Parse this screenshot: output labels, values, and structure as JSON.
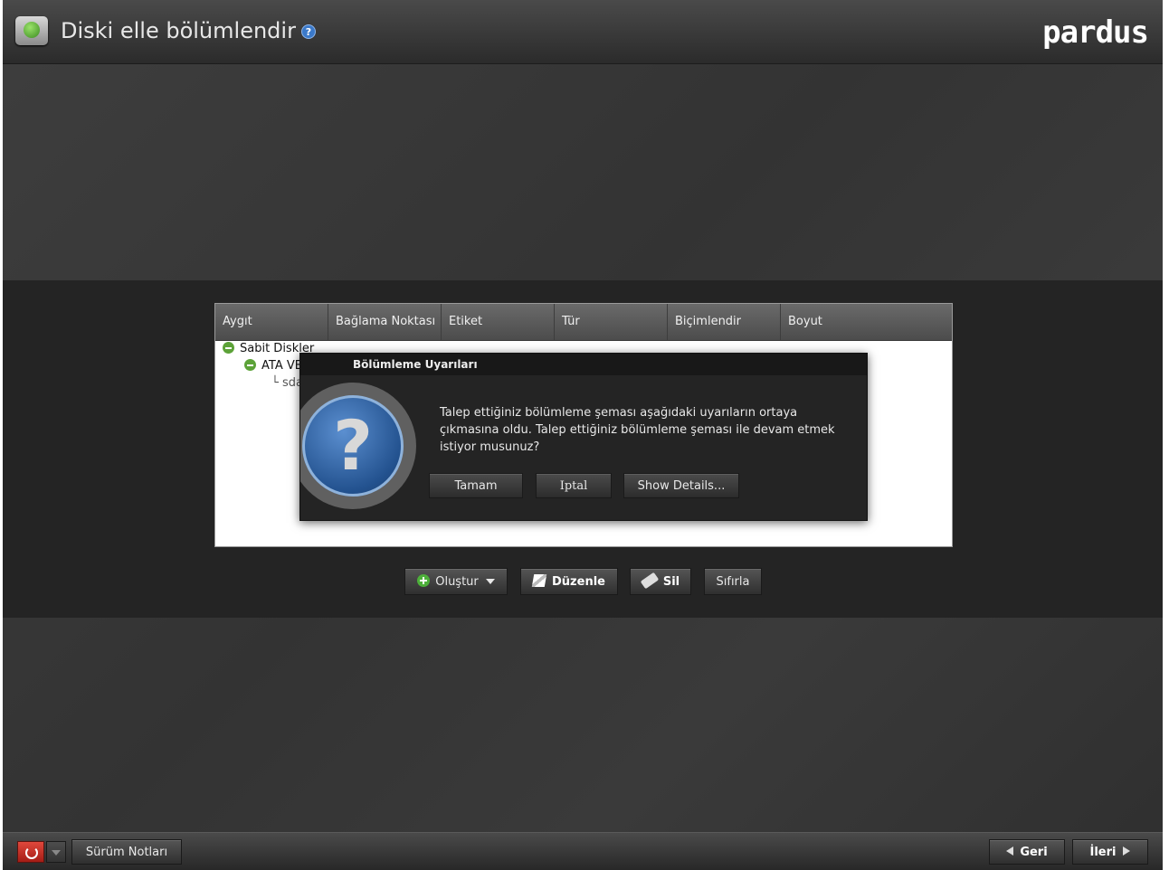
{
  "window": {
    "title": "Diski elle bölümlendir",
    "logo": "pardus"
  },
  "table": {
    "headers": [
      "Aygıt",
      "Bağlama Noktası",
      "Etiket",
      "Tür",
      "Biçimlendir",
      "Boyut"
    ],
    "rows": [
      "Sabit Diskler",
      "ATA VBOX HARDDISK",
      "sda1"
    ]
  },
  "dialog": {
    "title": "Bölümleme Uyarıları",
    "message": "Talep ettiğiniz bölümleme şeması aşağıdaki uyarıların ortaya çıkmasına oldu. Talep ettiğiniz bölümleme şeması ile devam etmek istiyor musunuz?",
    "ok_label": "Tamam",
    "cancel_label": "Iptal",
    "details_label": "Show Details..."
  },
  "toolbar": {
    "create_label": "Oluştur",
    "edit_label": "Düzenle",
    "delete_label": "Sil",
    "reset_label": "Sıfırla"
  },
  "footer": {
    "release_notes_label": "Sürüm Notları",
    "back_label": "Geri",
    "next_label": "İleri"
  }
}
